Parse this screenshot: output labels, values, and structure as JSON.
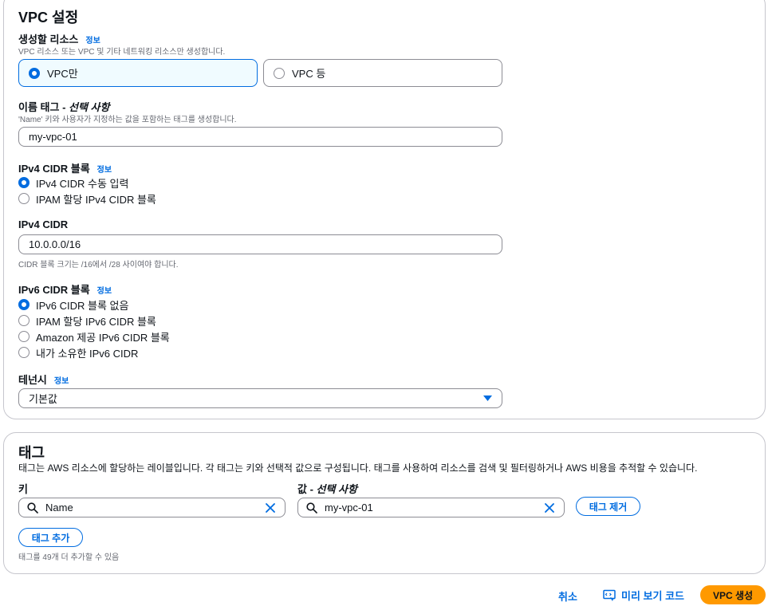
{
  "vpc_settings": {
    "title": "VPC 설정",
    "resources": {
      "label": "생성할 리소스",
      "info": "정보",
      "description": "VPC 리소스 또는 VPC 및 기타 네트워킹 리소스만 생성합니다.",
      "options": [
        "VPC만",
        "VPC 등"
      ],
      "selected": "VPC만"
    },
    "name_tag": {
      "label": "이름 태그 - ",
      "optional": "선택 사항",
      "description": "'Name' 키와 사용자가 지정하는 값을 포함하는 태그를 생성합니다.",
      "value": "my-vpc-01"
    },
    "ipv4_block": {
      "label": "IPv4 CIDR 블록",
      "info": "정보",
      "options": [
        "IPv4 CIDR 수동 입력",
        "IPAM 할당 IPv4 CIDR 블록"
      ],
      "selected": "IPv4 CIDR 수동 입력"
    },
    "ipv4_cidr": {
      "label": "IPv4 CIDR",
      "value": "10.0.0.0/16",
      "hint": "CIDR 블록 크기는 /16에서 /28 사이여야 합니다."
    },
    "ipv6_block": {
      "label": "IPv6 CIDR 블록",
      "info": "정보",
      "options": [
        "IPv6 CIDR 블록 없음",
        "IPAM 할당 IPv6 CIDR 블록",
        "Amazon 제공 IPv6 CIDR 블록",
        "내가 소유한 IPv6 CIDR"
      ],
      "selected": "IPv6 CIDR 블록 없음"
    },
    "tenancy": {
      "label": "테넌시",
      "info": "정보",
      "value": "기본값"
    }
  },
  "tags": {
    "title": "태그",
    "description": "태그는 AWS 리소스에 할당하는 레이블입니다. 각 태그는 키와 선택적 값으로 구성됩니다. 태그를 사용하여 리소스를 검색 및 필터링하거나 AWS 비용을 추적할 수 있습니다.",
    "key_label": "키",
    "value_label": "값 - ",
    "value_optional": "선택 사항",
    "key_value": "Name",
    "value_value": "my-vpc-01",
    "remove_label": "태그 제거",
    "add_label": "태그 추가",
    "remaining": "태그를 49개 더 추가할 수 있음"
  },
  "footer": {
    "cancel": "취소",
    "preview": "미리 보기 코드",
    "create": "VPC 생성"
  },
  "colors": {
    "accent": "#006ce0",
    "primary_button": "#ff9900",
    "selected_tile_bg": "#f0fbff"
  }
}
